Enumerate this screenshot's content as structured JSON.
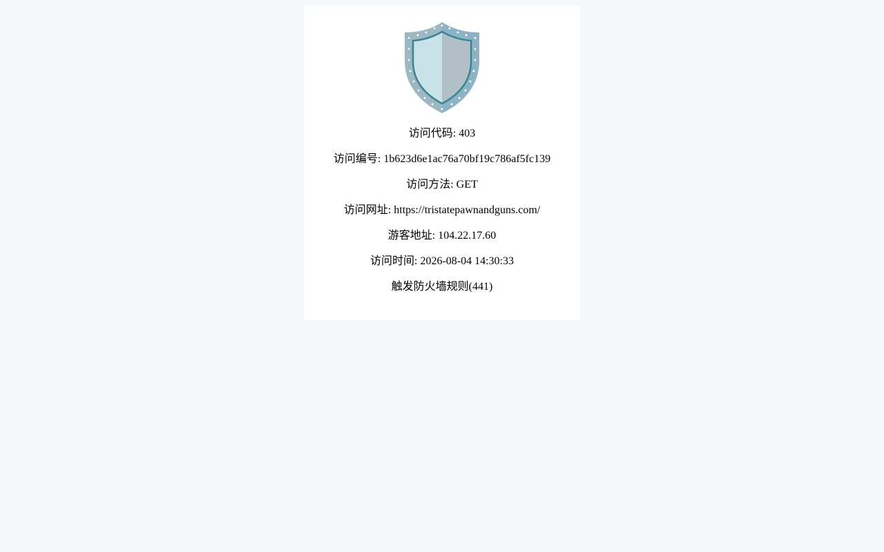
{
  "page": {
    "background_color": "#f3f7fa",
    "card_color": "#ffffff"
  },
  "shield": {
    "icon": "shield-icon",
    "colors": {
      "rim": "#9fb7c2",
      "rim_right": "#88b4c5",
      "stroke": "#3c8091",
      "inner_left": "#c8e2e7",
      "inner_right": "#b1c0c6",
      "rivet": "#ffffff"
    }
  },
  "info": {
    "code_label": "访问代码",
    "code_value": "403",
    "id_label": "访问编号",
    "id_value": "1b623d6e1ac76a70bf19c786af5fc139",
    "method_label": "访问方法",
    "method_value": "GET",
    "url_label": "访问网址",
    "url_value": "https://tristatepawnandguns.com/",
    "ip_label": "游客地址",
    "ip_value": "104.22.17.60",
    "time_label": "访问时间",
    "time_value": "2026-08-04 14:30:33",
    "rule_text": "触发防火墙规则(441)"
  }
}
